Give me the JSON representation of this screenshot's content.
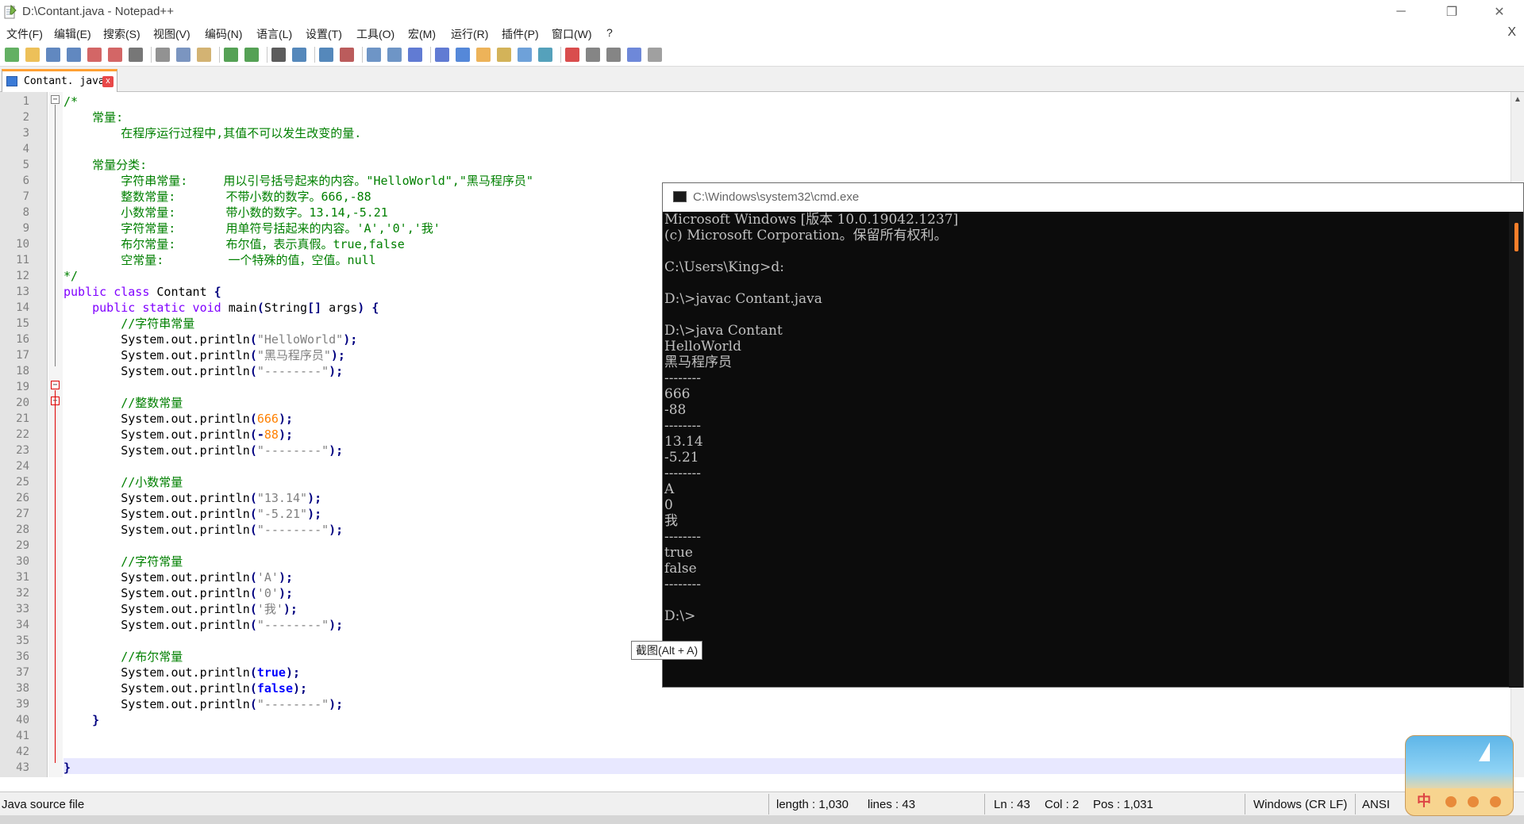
{
  "window": {
    "title": "D:\\Contant.java - Notepad++",
    "controls": {
      "minimize": "─",
      "restore": "❐",
      "close": "✕"
    }
  },
  "menu": {
    "items": [
      "文件(F)",
      "编辑(E)",
      "搜索(S)",
      "视图(V)",
      "编码(N)",
      "语言(L)",
      "设置(T)",
      "工具(O)",
      "宏(M)",
      "运行(R)",
      "插件(P)",
      "窗口(W)",
      "?"
    ],
    "close_doc": "X"
  },
  "toolbar": {
    "icons": [
      "new-file-icon",
      "open-file-icon",
      "save-icon",
      "save-all-icon",
      "close-icon",
      "close-all-icon",
      "print-icon",
      "cut-icon",
      "copy-icon",
      "paste-icon",
      "undo-icon",
      "redo-icon",
      "find-icon",
      "replace-icon",
      "zoom-in-icon",
      "zoom-out-icon",
      "sync-v-icon",
      "sync-h-icon",
      "wrap-icon",
      "show-all-chars-icon",
      "indent-guide-icon",
      "doc-map-icon",
      "function-list-icon",
      "folder-workspace-icon",
      "monitor-icon",
      "record-macro-icon",
      "stop-record-icon",
      "play-macro-icon",
      "run-macro-multiple-icon",
      "save-macro-icon"
    ]
  },
  "tab": {
    "label": "Contant. java",
    "close_icon": "x"
  },
  "editor": {
    "line_numbers": [
      "1",
      "2",
      "3",
      "4",
      "5",
      "6",
      "7",
      "8",
      "9",
      "10",
      "11",
      "12",
      "13",
      "14",
      "15",
      "16",
      "17",
      "18",
      "19",
      "20",
      "21",
      "22",
      "23",
      "24",
      "25",
      "26",
      "27",
      "28",
      "29",
      "30",
      "31",
      "32",
      "33",
      "34",
      "35",
      "36",
      "37",
      "38",
      "39",
      "40",
      "41",
      "42",
      "43"
    ],
    "lines": [
      [
        [
          "c-com",
          "/*"
        ]
      ],
      [
        [
          "c-com",
          "    常量:"
        ]
      ],
      [
        [
          "c-com",
          "        在程序运行过程中,其值不可以发生改变的量."
        ]
      ],
      [
        [
          "c-com",
          ""
        ]
      ],
      [
        [
          "c-com",
          "    常量分类:"
        ]
      ],
      [
        [
          "c-com",
          "        字符串常量:     用以引号括号起来的内容。\"HelloWorld\",\"黑马程序员\""
        ]
      ],
      [
        [
          "c-com",
          "        整数常量:       不带小数的数字。666,-88"
        ]
      ],
      [
        [
          "c-com",
          "        小数常量:       带小数的数字。13.14,-5.21"
        ]
      ],
      [
        [
          "c-com",
          "        字符常量:       用单符号括起来的内容。'A','0','我'"
        ]
      ],
      [
        [
          "c-com",
          "        布尔常量:       布尔值，表示真假。true,false"
        ]
      ],
      [
        [
          "c-com",
          "        空常量:         一个特殊的值，空值。null"
        ]
      ],
      [
        [
          "c-com",
          "*/"
        ]
      ],
      [
        [
          "c-kw",
          "public class "
        ],
        [
          "c-id",
          "Contant "
        ],
        [
          "c-op",
          "{"
        ]
      ],
      [
        [
          "c-id",
          "    "
        ],
        [
          "c-kw",
          "public static void "
        ],
        [
          "c-id",
          "main"
        ],
        [
          "c-op",
          "("
        ],
        [
          "c-id",
          "String"
        ],
        [
          "c-op",
          "[] "
        ],
        [
          "c-id",
          "args"
        ],
        [
          "c-op",
          ") {"
        ]
      ],
      [
        [
          "c-com",
          "        //字符串常量"
        ]
      ],
      [
        [
          "c-id",
          "        System.out.println"
        ],
        [
          "c-op",
          "("
        ],
        [
          "c-str",
          "\"HelloWorld\""
        ],
        [
          "c-op",
          ");"
        ]
      ],
      [
        [
          "c-id",
          "        System.out.println"
        ],
        [
          "c-op",
          "("
        ],
        [
          "c-str",
          "\"黑马程序员\""
        ],
        [
          "c-op",
          ");"
        ]
      ],
      [
        [
          "c-id",
          "        System.out.println"
        ],
        [
          "c-op",
          "("
        ],
        [
          "c-str",
          "\"--------\""
        ],
        [
          "c-op",
          ");"
        ]
      ],
      [
        [
          "c-id",
          ""
        ]
      ],
      [
        [
          "c-com",
          "        //整数常量"
        ]
      ],
      [
        [
          "c-id",
          "        System.out.println"
        ],
        [
          "c-op",
          "("
        ],
        [
          "c-num",
          "666"
        ],
        [
          "c-op",
          ");"
        ]
      ],
      [
        [
          "c-id",
          "        System.out.println"
        ],
        [
          "c-op",
          "(-"
        ],
        [
          "c-num",
          "88"
        ],
        [
          "c-op",
          ");"
        ]
      ],
      [
        [
          "c-id",
          "        System.out.println"
        ],
        [
          "c-op",
          "("
        ],
        [
          "c-str",
          "\"--------\""
        ],
        [
          "c-op",
          ");"
        ]
      ],
      [
        [
          "c-id",
          ""
        ]
      ],
      [
        [
          "c-com",
          "        //小数常量"
        ]
      ],
      [
        [
          "c-id",
          "        System.out.println"
        ],
        [
          "c-op",
          "("
        ],
        [
          "c-str",
          "\"13.14\""
        ],
        [
          "c-op",
          ");"
        ]
      ],
      [
        [
          "c-id",
          "        System.out.println"
        ],
        [
          "c-op",
          "("
        ],
        [
          "c-str",
          "\"-5.21\""
        ],
        [
          "c-op",
          ");"
        ]
      ],
      [
        [
          "c-id",
          "        System.out.println"
        ],
        [
          "c-op",
          "("
        ],
        [
          "c-str",
          "\"--------\""
        ],
        [
          "c-op",
          ");"
        ]
      ],
      [
        [
          "c-id",
          ""
        ]
      ],
      [
        [
          "c-com",
          "        //字符常量"
        ]
      ],
      [
        [
          "c-id",
          "        System.out.println"
        ],
        [
          "c-op",
          "("
        ],
        [
          "c-str",
          "'A'"
        ],
        [
          "c-op",
          ");"
        ]
      ],
      [
        [
          "c-id",
          "        System.out.println"
        ],
        [
          "c-op",
          "("
        ],
        [
          "c-str",
          "'0'"
        ],
        [
          "c-op",
          ");"
        ]
      ],
      [
        [
          "c-id",
          "        System.out.println"
        ],
        [
          "c-op",
          "("
        ],
        [
          "c-str",
          "'我'"
        ],
        [
          "c-op",
          ");"
        ]
      ],
      [
        [
          "c-id",
          "        System.out.println"
        ],
        [
          "c-op",
          "("
        ],
        [
          "c-str",
          "\"--------\""
        ],
        [
          "c-op",
          ");"
        ]
      ],
      [
        [
          "c-id",
          ""
        ]
      ],
      [
        [
          "c-com",
          "        //布尔常量"
        ]
      ],
      [
        [
          "c-id",
          "        System.out.println"
        ],
        [
          "c-op",
          "("
        ],
        [
          "c-kw2",
          "true"
        ],
        [
          "c-op",
          ");"
        ]
      ],
      [
        [
          "c-id",
          "        System.out.println"
        ],
        [
          "c-op",
          "("
        ],
        [
          "c-kw2",
          "false"
        ],
        [
          "c-op",
          ");"
        ]
      ],
      [
        [
          "c-id",
          "        System.out.println"
        ],
        [
          "c-op",
          "("
        ],
        [
          "c-str",
          "\"--------\""
        ],
        [
          "c-op",
          ");"
        ]
      ],
      [
        [
          "c-op",
          "    }"
        ]
      ],
      [
        [
          "c-id",
          ""
        ]
      ],
      [
        [
          "c-id",
          ""
        ]
      ],
      [
        [
          "c-op",
          "}"
        ]
      ]
    ]
  },
  "statusbar": {
    "filetype": "Java source file",
    "length": "length : 1,030",
    "lines": "lines : 43",
    "ln": "Ln : 43",
    "col": "Col : 2",
    "pos": "Pos : 1,031",
    "eol": "Windows (CR LF)",
    "encoding": "ANSI"
  },
  "cmd": {
    "title": "C:\\Windows\\system32\\cmd.exe",
    "lines": [
      "Microsoft Windows [版本 10.0.19042.1237]",
      "(c) Microsoft Corporation。保留所有权利。",
      "",
      "C:\\Users\\King>d:",
      "",
      "D:\\>javac Contant.java",
      "",
      "D:\\>java Contant",
      "HelloWorld",
      "黑马程序员",
      "--------",
      "666",
      "-88",
      "--------",
      "13.14",
      "-5.21",
      "--------",
      "A",
      "0",
      "我",
      "--------",
      "true",
      "false",
      "--------",
      "",
      "D:\\>"
    ]
  },
  "tooltip": {
    "text": "截图(Alt + A)"
  },
  "ime": {
    "mode_char": "中"
  }
}
